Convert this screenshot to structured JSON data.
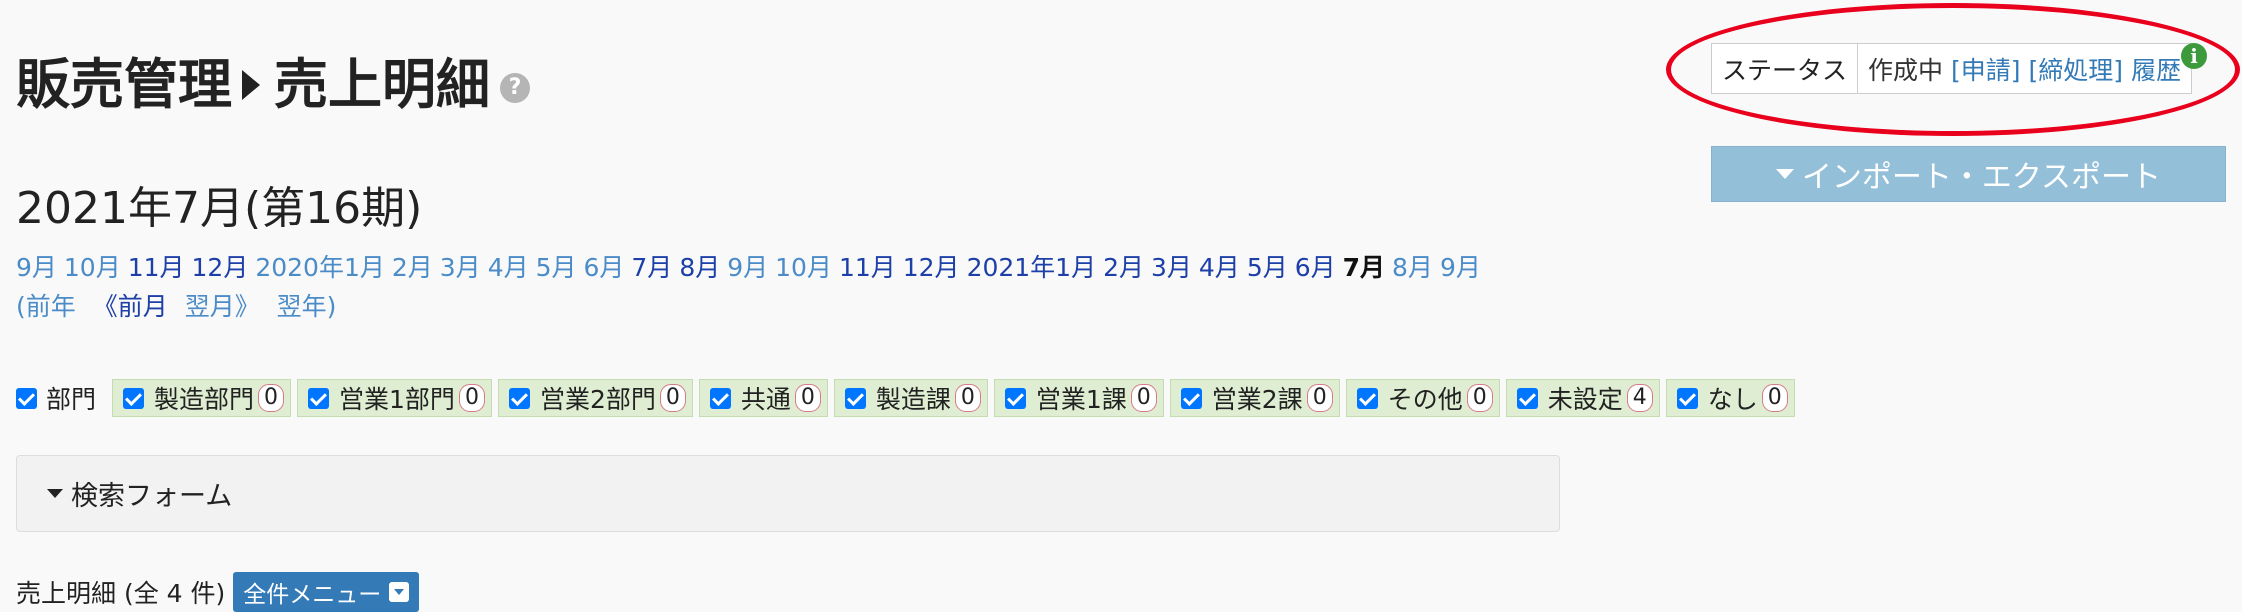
{
  "header": {
    "section": "販売管理",
    "page": "売上明細",
    "help_icon": "question-circle-icon"
  },
  "status": {
    "label": "ステータス",
    "value": "作成中",
    "actions": [
      "[申請]",
      "[締処理]",
      "履歴"
    ],
    "info_icon": "info-circle-icon",
    "highlight_color": "#e8001c"
  },
  "import_export": {
    "label": "インポート・エクスポート"
  },
  "period": {
    "title": "2021年7月(第16期)"
  },
  "months": [
    {
      "label": "9月",
      "style": "light"
    },
    {
      "label": "10月",
      "style": "light"
    },
    {
      "label": "11月",
      "style": "dark"
    },
    {
      "label": "12月",
      "style": "dark"
    },
    {
      "label": "2020年1月",
      "style": "light"
    },
    {
      "label": "2月",
      "style": "light"
    },
    {
      "label": "3月",
      "style": "light"
    },
    {
      "label": "4月",
      "style": "light"
    },
    {
      "label": "5月",
      "style": "light"
    },
    {
      "label": "6月",
      "style": "light"
    },
    {
      "label": "7月",
      "style": "dark"
    },
    {
      "label": "8月",
      "style": "dark"
    },
    {
      "label": "9月",
      "style": "light"
    },
    {
      "label": "10月",
      "style": "light"
    },
    {
      "label": "11月",
      "style": "dark"
    },
    {
      "label": "12月",
      "style": "dark"
    },
    {
      "label": "2021年1月",
      "style": "dark"
    },
    {
      "label": "2月",
      "style": "dark"
    },
    {
      "label": "3月",
      "style": "dark"
    },
    {
      "label": "4月",
      "style": "dark"
    },
    {
      "label": "5月",
      "style": "dark"
    },
    {
      "label": "6月",
      "style": "dark"
    },
    {
      "label": "7月",
      "style": "current"
    },
    {
      "label": "8月",
      "style": "light"
    },
    {
      "label": "9月",
      "style": "light"
    }
  ],
  "nav": {
    "prev_year": "(前年",
    "prev_month": "《前月",
    "next_month": "翌月》",
    "next_year": "翌年)"
  },
  "departments": {
    "label": "部門",
    "items": [
      {
        "name": "製造部門",
        "count": "0"
      },
      {
        "name": "営業1部門",
        "count": "0"
      },
      {
        "name": "営業2部門",
        "count": "0"
      },
      {
        "name": "共通",
        "count": "0"
      },
      {
        "name": "製造課",
        "count": "0"
      },
      {
        "name": "営業1課",
        "count": "0"
      },
      {
        "name": "営業2課",
        "count": "0"
      },
      {
        "name": "その他",
        "count": "0"
      },
      {
        "name": "未設定",
        "count": "4"
      },
      {
        "name": "なし",
        "count": "0"
      }
    ]
  },
  "search_form": {
    "label": "検索フォーム"
  },
  "summary": {
    "text": "売上明細 (全 4 件)",
    "menu_label": "全件メニュー"
  }
}
